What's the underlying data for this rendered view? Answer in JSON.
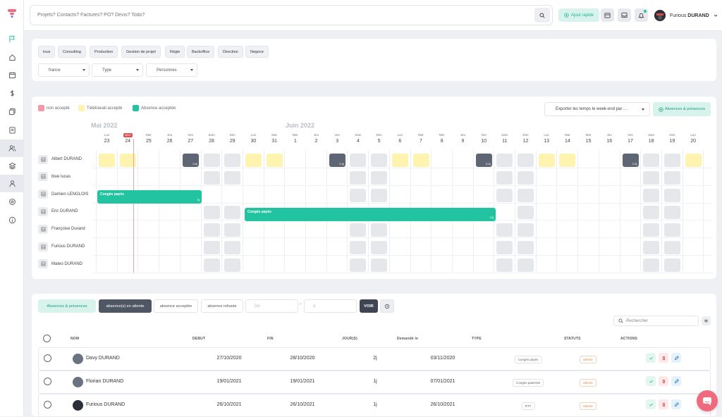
{
  "topbar": {
    "search_placeholder": "Projets? Contacts? Factures? PO? Devis? Todo?",
    "quick_add_label": "Ajout rapide",
    "user_first": "Furious",
    "user_last": "DURAND"
  },
  "filters": {
    "chips": [
      "tous",
      "Consulting",
      "Production",
      "Gestion de projet",
      "Régie",
      "Backoffice",
      "Direction",
      "Negoce"
    ],
    "country": "france",
    "type": "Type",
    "people": "Personnes"
  },
  "calendar": {
    "legend": {
      "pending": "non accepté",
      "telework": "Télétravail accepté",
      "accepted": "Absence acceptée"
    },
    "legend_colors": {
      "pending": "#f29aa6",
      "telework": "#fff3b0",
      "accepted": "#22c3a0"
    },
    "export_label": "Exporter les temps le week-end par ...",
    "absences_button": "Absences & présences",
    "month_may": "Mai 2022",
    "month_june": "Juin 2022",
    "today_badge": "MDH",
    "days": [
      {
        "n": "Lun",
        "d": "23"
      },
      {
        "n": "",
        "d": "24"
      },
      {
        "n": "Mer",
        "d": "25"
      },
      {
        "n": "Jeu",
        "d": "26"
      },
      {
        "n": "Ven",
        "d": "27"
      },
      {
        "n": "Sam",
        "d": "28"
      },
      {
        "n": "Dim",
        "d": "29"
      },
      {
        "n": "Lun",
        "d": "30"
      },
      {
        "n": "Mar",
        "d": "31"
      },
      {
        "n": "Mer",
        "d": "1"
      },
      {
        "n": "Jeu",
        "d": "2"
      },
      {
        "n": "Ven",
        "d": "3"
      },
      {
        "n": "Sam",
        "d": "4"
      },
      {
        "n": "Dim",
        "d": "5"
      },
      {
        "n": "Lun",
        "d": "6"
      },
      {
        "n": "Mar",
        "d": "7"
      },
      {
        "n": "Mer",
        "d": "8"
      },
      {
        "n": "Jeu",
        "d": "9"
      },
      {
        "n": "Ven",
        "d": "10"
      },
      {
        "n": "Sam",
        "d": "11"
      },
      {
        "n": "Dim",
        "d": "12"
      },
      {
        "n": "Lun",
        "d": "13"
      },
      {
        "n": "Mar",
        "d": "14"
      },
      {
        "n": "Mer",
        "d": "15"
      },
      {
        "n": "Jeu",
        "d": "16"
      },
      {
        "n": "Ven",
        "d": "17"
      },
      {
        "n": "Sam",
        "d": "18"
      },
      {
        "n": "Dim",
        "d": "19"
      },
      {
        "n": "Lun",
        "d": "20"
      }
    ],
    "employees": [
      "Albert DURAND",
      "blue lucas",
      "Damien LENGLOIS",
      "Eric DURAND",
      "Françoise Durand",
      "Furious DURAND",
      "Mateo DURAND"
    ],
    "half_day_label": "0.5j",
    "bar1_label": "Congés payés",
    "bar1_sub": "5j",
    "bar2_label": "Congés payés",
    "bar2_sub": "12j"
  },
  "list": {
    "tab_absences": "Absences & présences",
    "tab_pending": "absence(s) en attente",
    "tab_accepted": "absence acceptée",
    "tab_refused": "absence refusée",
    "date_from": "De",
    "date_to": "à",
    "dash": "-",
    "view_button": "VOIR",
    "search_placeholder": "Rechercher",
    "headers": {
      "nom": "NOM",
      "debut": "DEBUT",
      "fin": "FIN",
      "jours": "JOUR(S)",
      "demande": "Demandé le",
      "type": "TYPE",
      "statuts": "STATUTS",
      "actions": "ACTIONS"
    },
    "rows": [
      {
        "name": "Davy DURAND",
        "debut": "27/10/2020",
        "fin": "28/10/2020",
        "jours": "2j",
        "demande": "03/11/2020",
        "type": "Congés payés",
        "status": "attente"
      },
      {
        "name": "Florian DURAND",
        "debut": "19/01/2021",
        "fin": "19/01/2021",
        "jours": "1j",
        "demande": "07/01/2021",
        "type": "Congés paternité",
        "status": "attente"
      },
      {
        "name": "Furious DURAND",
        "debut": "26/10/2021",
        "fin": "26/10/2021",
        "jours": "1j",
        "demande": "26/10/2021",
        "type": "RTT",
        "status": "attente"
      }
    ]
  }
}
